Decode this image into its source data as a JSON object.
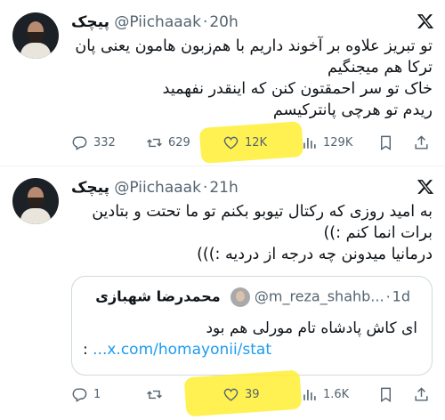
{
  "tweets": [
    {
      "author_name": "پیچک",
      "handle": "@Piichaaak",
      "time": "20h",
      "lines": [
        "تو تبریز علاوه بر آخوند داریم با هم‌زبون هامون یعنی پان",
        "ترکا هم میجنگیم",
        "خاک تو سر احمقتون کنن که اینقدر نفهمید",
        "ریدم تو هرچی پانترکیسم"
      ],
      "stats": {
        "replies": "332",
        "retweets": "629",
        "likes": "12K",
        "views": "129K"
      }
    },
    {
      "author_name": "پیچک",
      "handle": "@Piichaaak",
      "time": "21h",
      "lines": [
        "به امید روزی که رکتال تیوبو بکنم تو ما تحتت و بتادین",
        "برات انما کنم :))",
        "درمانیا میدونن چه درجه از دردیه :)))"
      ],
      "quote": {
        "author_name": "محمدرضا شهبازی",
        "handle": "@m_reza_shahb...",
        "time": "1d",
        "text": "ای کاش پادشاه تام مورلی هم بود",
        "link_prefix": ": ",
        "link": "...x.com/homayonii/stat"
      },
      "stats": {
        "replies": "1",
        "retweets": "",
        "likes": "39",
        "views": "1.6K"
      }
    }
  ],
  "icons": {
    "reply": "reply-icon",
    "retweet": "retweet-icon",
    "like": "heart-icon",
    "views": "views-icon",
    "bookmark": "bookmark-icon",
    "share": "share-icon",
    "logo": "x-logo-icon"
  },
  "colors": {
    "text": "#0f1419",
    "secondary": "#536471",
    "link": "#1d9bf0",
    "highlight": "#ffee33",
    "border": "#cfd9de"
  }
}
